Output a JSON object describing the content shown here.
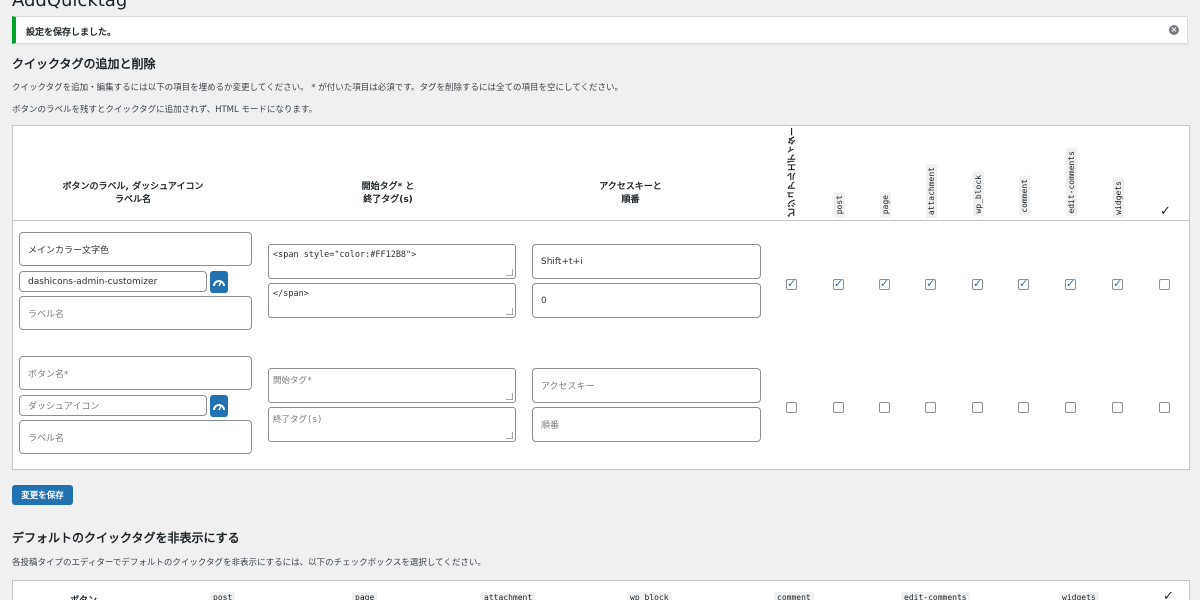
{
  "page_title": "AddQuicktag",
  "notice": {
    "text": "設定を保存しました。",
    "dismiss_icon": "close-circle-icon"
  },
  "section1": {
    "title": "クイックタグの追加と削除",
    "desc1": "クイックタグを追加・編集するには以下の項目を埋めるか変更してください。 * が付いた項目は必須です。タグを削除するには全ての項目を空にしてください。",
    "desc2": "ボタンのラベルを残すとクイックタグに追加されず、HTML モードになります。"
  },
  "table": {
    "col_label": [
      "ボタンのラベル, ダッシュアイコン",
      "ラベル名"
    ],
    "col_tags": [
      "開始タグ* と",
      "終了タグ(s)"
    ],
    "col_access": [
      "アクセスキーと",
      "順番"
    ],
    "vertical_headers": [
      "ビジュアルエディター",
      "post",
      "page",
      "attachment",
      "wp_block",
      "comment",
      "edit-comments",
      "widgets"
    ],
    "check_all": "✓",
    "rows": [
      {
        "button_name": "メインカラー文字色",
        "dashicon": "dashicons-admin-customizer",
        "label_name_placeholder": "ラベル名",
        "start_tag": "<span style=\"color:#FF12B8\">",
        "end_tag": "</span>",
        "access_key": "Shift+t+i",
        "order": "0",
        "checks": [
          true,
          true,
          true,
          true,
          true,
          true,
          true,
          true,
          false
        ]
      },
      {
        "button_name_placeholder": "ボタン名*",
        "dashicon_placeholder": "ダッシュアイコン",
        "label_name_placeholder": "ラベル名",
        "start_tag_placeholder": "開始タグ*",
        "end_tag_placeholder": "終了タグ(s)",
        "access_key_placeholder": "アクセスキー",
        "order_placeholder": "順番",
        "checks": [
          false,
          false,
          false,
          false,
          false,
          false,
          false,
          false,
          false
        ]
      }
    ]
  },
  "save_button": "変更を保存",
  "section2": {
    "title": "デフォルトのクイックタグを非表示にする",
    "desc": "各投稿タイプのエディターでデフォルトのクイックタグを非表示にするには、以下のチェックボックスを選択してください。",
    "headers": [
      "ボタン",
      "post",
      "page",
      "attachment",
      "wp_block",
      "comment",
      "edit-comments",
      "widgets",
      "✓"
    ]
  },
  "colors": {
    "accent": "#2271b1",
    "notice_success": "#00a32a"
  }
}
